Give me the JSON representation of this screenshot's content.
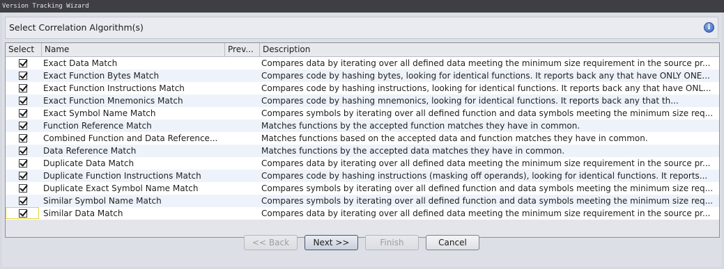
{
  "window": {
    "title": "Version Tracking Wizard"
  },
  "panel": {
    "title": "Select Correlation Algorithm(s)",
    "info_icon": "info-icon"
  },
  "table": {
    "columns": [
      "Select",
      "Name",
      "Prev...",
      "Description"
    ],
    "rows": [
      {
        "checked": true,
        "name": "Exact Data Match",
        "prev": "",
        "description": "Compares data by iterating over all defined data meeting the minimum size requirement in the source pr..."
      },
      {
        "checked": true,
        "name": "Exact Function Bytes Match",
        "prev": "",
        "description": "Compares code by hashing bytes, looking for identical functions. It reports back any that have ONLY ONE..."
      },
      {
        "checked": true,
        "name": "Exact Function Instructions Match",
        "prev": "",
        "description": "Compares code by hashing instructions, looking for identical functions. It reports back any that have ONL..."
      },
      {
        "checked": true,
        "name": "Exact Function Mnemonics Match",
        "prev": "",
        "description": "Compares code by hashing mnemonics, looking for identical functions. It reports back any that th..."
      },
      {
        "checked": true,
        "name": "Exact Symbol Name Match",
        "prev": "",
        "description": "Compares symbols by iterating over all defined function and data symbols meeting the minimum size req..."
      },
      {
        "checked": true,
        "name": "Function Reference Match",
        "prev": "",
        "description": "Matches functions by the accepted function matches they have in common."
      },
      {
        "checked": true,
        "name": "Combined Function and Data Reference...",
        "prev": "",
        "description": "Matches functions based on the accepted data and function matches they have in common."
      },
      {
        "checked": true,
        "name": "Data Reference Match",
        "prev": "",
        "description": "Matches functions by the accepted data matches they have in common."
      },
      {
        "checked": true,
        "name": "Duplicate Data Match",
        "prev": "",
        "description": "Compares data by iterating over all defined data meeting the minimum size requirement in the source pr..."
      },
      {
        "checked": true,
        "name": "Duplicate Function Instructions Match",
        "prev": "",
        "description": "Compares code by hashing instructions (masking off operands), looking for identical functions.  It reports..."
      },
      {
        "checked": true,
        "name": "Duplicate Exact Symbol Name Match",
        "prev": "",
        "description": "Compares symbols by iterating over all defined function and data symbols meeting the minimum size req..."
      },
      {
        "checked": true,
        "name": "Similar Symbol Name Match",
        "prev": "",
        "description": "Compares symbols by iterating over all defined function and data symbols meeting the minimum size req..."
      },
      {
        "checked": true,
        "name": "Similar Data Match",
        "prev": "",
        "description": "Compares data by iterating over all defined data meeting the minimum size requirement in the source pr..."
      }
    ]
  },
  "buttons": {
    "back": {
      "label": "<< Back",
      "enabled": false
    },
    "next": {
      "label": "Next >>",
      "enabled": true
    },
    "finish": {
      "label": "Finish",
      "enabled": false
    },
    "cancel": {
      "label": "Cancel",
      "enabled": true
    }
  },
  "colors": {
    "title_bar": "#3f3e45",
    "row_alt": "#eef3fb",
    "focus": "#e4d33a"
  }
}
